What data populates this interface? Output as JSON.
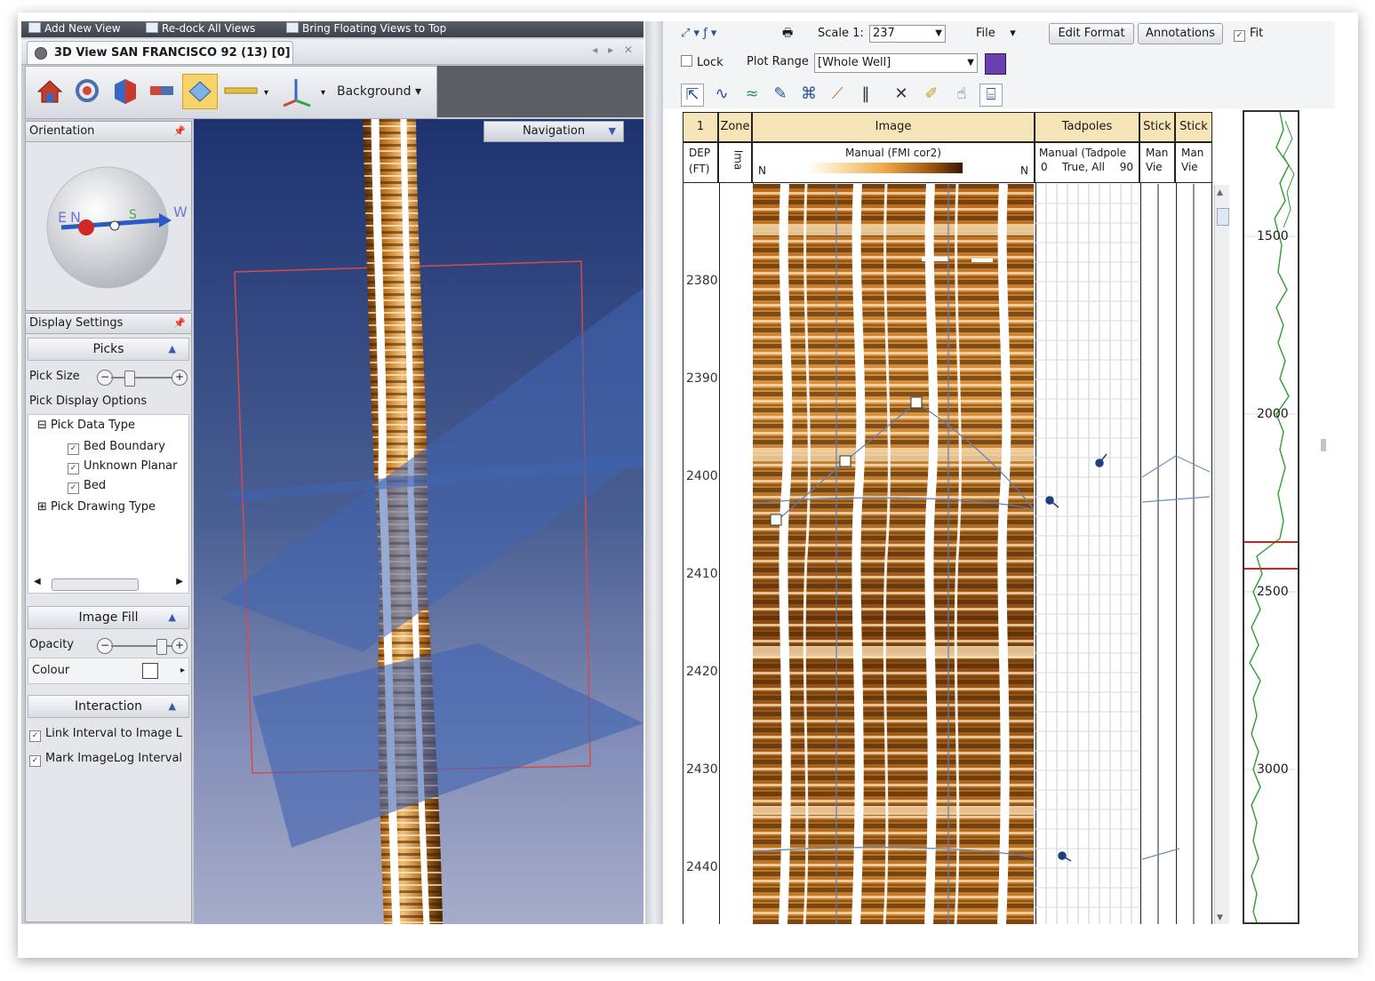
{
  "left_window": {
    "command_bar": [
      "Add New View",
      "Re-dock All Views",
      "Bring Floating Views to Top"
    ],
    "tab_title": "3D View SAN FRANCISCO 92 (13) [0]",
    "toolbar": {
      "background_label": "Background"
    },
    "orientation_panel": {
      "title": "Orientation",
      "compass": [
        "E",
        "N",
        "S",
        "W"
      ]
    },
    "display_settings": {
      "title": "Display Settings",
      "picks_header": "Picks",
      "pick_size_label": "Pick Size",
      "pick_display_options": "Pick Display Options",
      "tree": {
        "pick_data_type": "Pick Data Type",
        "items": [
          "Bed Boundary",
          "Unknown Planar",
          "Bed"
        ],
        "pick_drawing_type": "Pick Drawing Type"
      },
      "image_fill_header": "Image Fill",
      "opacity_label": "Opacity",
      "opacity_level": 0.85,
      "pick_size_level": 0.25,
      "colour_label": "Colour",
      "interaction_header": "Interaction",
      "link_interval": "Link Interval to Image L",
      "mark_interval": "Mark ImageLog Interval"
    },
    "navigation_label": "Navigation"
  },
  "right_window": {
    "toolbar": {
      "scale_label": "Scale 1:",
      "scale_value": "237",
      "file_label": "File",
      "edit_format": "Edit Format",
      "annotations": "Annotations",
      "fit_label": "Fit",
      "lock_label": "Lock",
      "plot_range_label": "Plot Range",
      "plot_range_value": "[Whole Well]"
    },
    "tracks": {
      "depth": {
        "num": "1",
        "units": [
          "DEP",
          "(FT)"
        ]
      },
      "zone": {
        "title": "Zone",
        "sub": "Ima"
      },
      "image": {
        "title": "Image",
        "sub": "Manual (FMI cor2)",
        "left": "N",
        "right": "N"
      },
      "tadpoles": {
        "title": "Tadpoles",
        "sub": "Manual (Tadpole",
        "sub2_left": "0",
        "sub2_mid": "True, All",
        "sub2_right": "90"
      },
      "stick1": {
        "title": "Stick",
        "sub1": "Man",
        "sub2": "Vie"
      },
      "stick2": {
        "title": "Stick",
        "sub1": "Man",
        "sub2": "Vie"
      }
    },
    "depth_labels": [
      "2380",
      "2390",
      "2400",
      "2410",
      "2420",
      "2430",
      "2440"
    ],
    "curve_labels": [
      "1500",
      "2000",
      "2500",
      "3000"
    ],
    "colors": {
      "track_header": "#f6e5b9",
      "image_dark": "#6b3a08",
      "image_light": "#f2c47e",
      "curve": "#2f9e2f",
      "marker": "#d42020"
    }
  }
}
